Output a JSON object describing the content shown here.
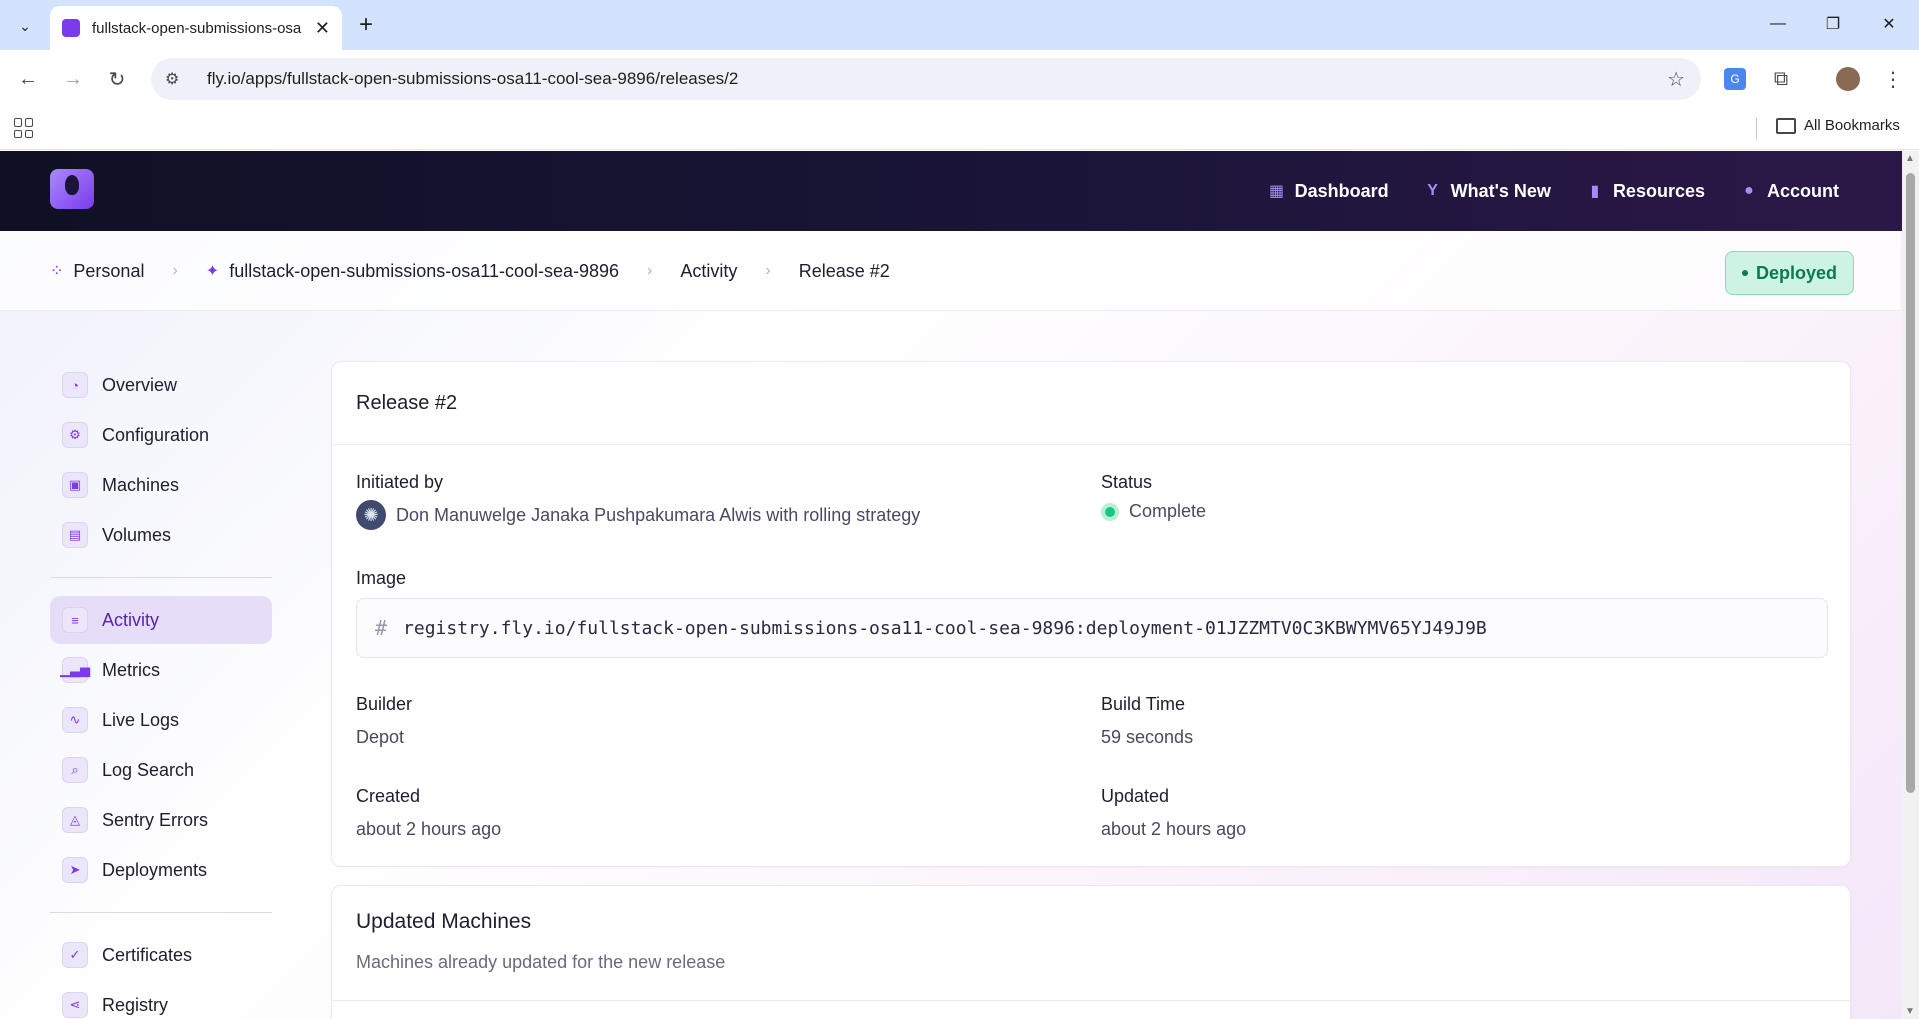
{
  "browser": {
    "tab_title": "fullstack-open-submissions-osa11-cool-sea-9896",
    "url": "fly.io/apps/fullstack-open-submissions-osa11-cool-sea-9896/releases/2",
    "all_bookmarks": "All Bookmarks"
  },
  "topnav": {
    "links": [
      {
        "label": "Dashboard",
        "icon": "dashboard-icon"
      },
      {
        "label": "What's New",
        "icon": "sprout-icon"
      },
      {
        "label": "Resources",
        "icon": "bookmark-icon"
      },
      {
        "label": "Account",
        "icon": "user-icon"
      }
    ]
  },
  "breadcrumb": {
    "items": [
      "Personal",
      "fullstack-open-submissions-osa11-cool-sea-9896",
      "Activity",
      "Release #2"
    ],
    "status_badge": "Deployed"
  },
  "sidebar": {
    "group1": [
      "Overview",
      "Configuration",
      "Machines",
      "Volumes"
    ],
    "group2": [
      "Activity",
      "Metrics",
      "Live Logs",
      "Log Search",
      "Sentry Errors",
      "Deployments"
    ],
    "group3": [
      "Certificates",
      "Registry"
    ],
    "active": "Activity"
  },
  "release": {
    "title": "Release #2",
    "initiated_by_label": "Initiated by",
    "initiated_by_value": "Don Manuwelge Janaka Pushpakumara Alwis with rolling strategy",
    "status_label": "Status",
    "status_value": "Complete",
    "image_label": "Image",
    "image_value": "registry.fly.io/fullstack-open-submissions-osa11-cool-sea-9896:deployment-01JZZMTV0C3KBWYMV65YJ49J9B",
    "builder_label": "Builder",
    "builder_value": "Depot",
    "build_time_label": "Build Time",
    "build_time_value": "59 seconds",
    "created_label": "Created",
    "created_value": "about 2 hours ago",
    "updated_label": "Updated",
    "updated_value": "about 2 hours ago"
  },
  "updated_machines": {
    "title": "Updated Machines",
    "subtitle": "Machines already updated for the new release"
  },
  "colors": {
    "accent": "#7c3aed",
    "deployed_bg": "#cdf3e3",
    "status_complete": "#16c784"
  }
}
